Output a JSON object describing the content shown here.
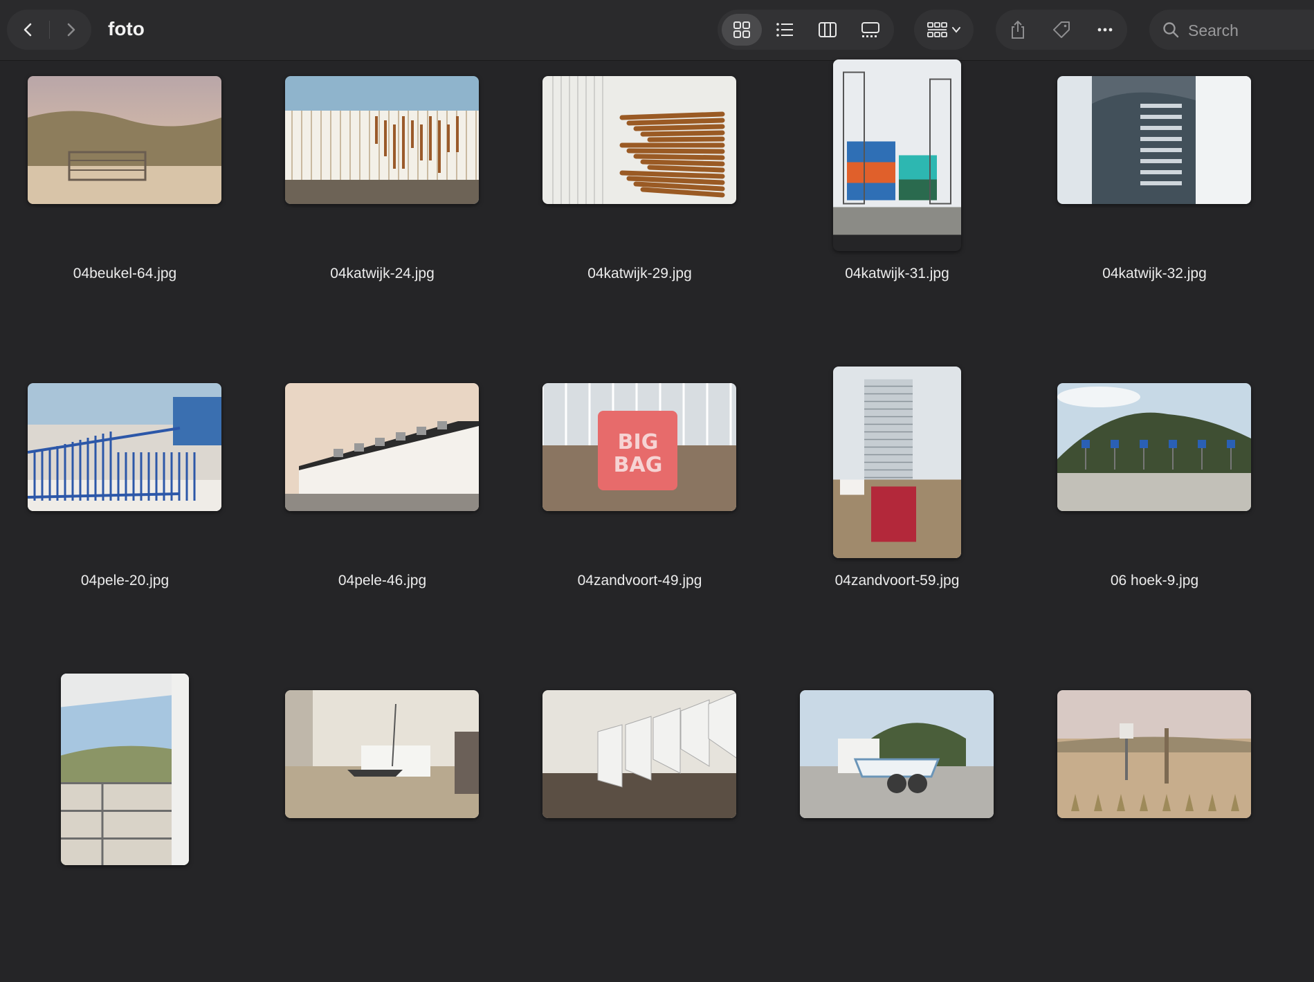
{
  "window": {
    "title": "foto"
  },
  "toolbar": {
    "back_icon": "chevron-left-icon",
    "forward_icon": "chevron-right-icon",
    "views": [
      "icon-view",
      "list-view",
      "column-view",
      "gallery-view"
    ],
    "active_view": "icon-view",
    "group_icon": "group-by-icon",
    "share_icon": "share-icon",
    "tag_icon": "tag-icon",
    "more_icon": "ellipsis-icon"
  },
  "search": {
    "placeholder": "Search"
  },
  "files": [
    {
      "name": "04beukel-64.jpg",
      "orientation": "landscape",
      "scene": "dune-gate"
    },
    {
      "name": "04katwijk-24.jpg",
      "orientation": "landscape",
      "scene": "white-wall-rust"
    },
    {
      "name": "04katwijk-29.jpg",
      "orientation": "landscape",
      "scene": "wood-stakes"
    },
    {
      "name": "04katwijk-31.jpg",
      "orientation": "portrait",
      "scene": "crates-trolley"
    },
    {
      "name": "04katwijk-32.jpg",
      "orientation": "landscape",
      "scene": "glass-door"
    },
    {
      "name": "04pele-20.jpg",
      "orientation": "landscape",
      "scene": "blue-gate"
    },
    {
      "name": "04pele-46.jpg",
      "orientation": "landscape",
      "scene": "white-building"
    },
    {
      "name": "04zandvoort-49.jpg",
      "orientation": "landscape",
      "scene": "big-bag"
    },
    {
      "name": "04zandvoort-59.jpg",
      "orientation": "portrait",
      "scene": "tower-sign"
    },
    {
      "name": "06 hoek-9.jpg",
      "orientation": "landscape",
      "scene": "parking-dune"
    },
    {
      "name": "",
      "orientation": "portrait",
      "scene": "balcony-dune"
    },
    {
      "name": "",
      "orientation": "landscape",
      "scene": "boat-shed"
    },
    {
      "name": "",
      "orientation": "landscape",
      "scene": "beach-huts"
    },
    {
      "name": "",
      "orientation": "landscape",
      "scene": "trailer-boat"
    },
    {
      "name": "",
      "orientation": "landscape",
      "scene": "dune-signpost"
    }
  ],
  "colors": {
    "background": "#252527",
    "toolbar": "#2a2a2c",
    "control": "#323234",
    "active": "#4a4a4c",
    "text": "#ececec"
  }
}
